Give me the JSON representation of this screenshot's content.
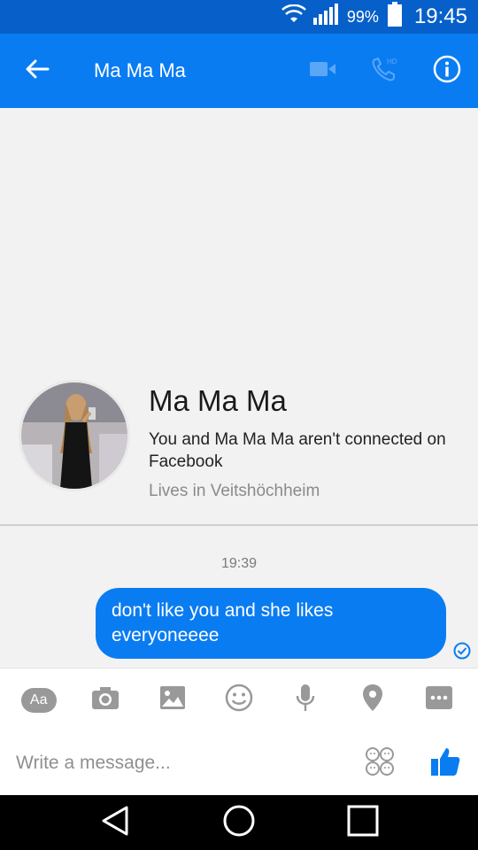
{
  "status_bar": {
    "battery_percent": "99%",
    "time": "19:45",
    "icons": [
      "wifi-icon",
      "signal-icon",
      "battery-icon"
    ]
  },
  "header": {
    "title": "Ma Ma Ma",
    "icons": [
      "back-arrow-icon",
      "video-call-icon",
      "hd-call-icon",
      "info-icon"
    ]
  },
  "profile": {
    "name": "Ma Ma Ma",
    "connection_text": "You and Ma Ma Ma aren't connected on Facebook",
    "location": "Lives in Veitshöchheim"
  },
  "thread": {
    "timestamp": "19:39",
    "messages": [
      {
        "text": "don't like you and she likes everyoneeee",
        "sent": true,
        "status": "sent-check"
      }
    ]
  },
  "composer": {
    "aa_label": "Aa",
    "placeholder": "Write a message...",
    "tools": [
      "text-format-icon",
      "camera-icon",
      "gallery-icon",
      "emoji-icon",
      "microphone-icon",
      "location-icon",
      "more-icon"
    ]
  },
  "nav_bar": {
    "icons": [
      "back-triangle-icon",
      "home-circle-icon",
      "recents-square-icon"
    ]
  },
  "colors": {
    "brand_blue": "#0a7cf2",
    "status_bar_blue": "#0760c9",
    "background": "#f2f2f2"
  }
}
